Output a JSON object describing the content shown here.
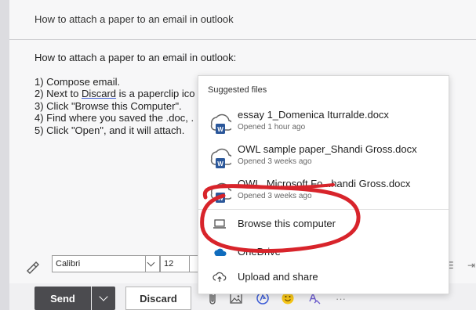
{
  "compose": {
    "subject": "How to attach a paper to an email in outlook",
    "body_title": "How to attach a paper to an email in outlook:",
    "steps": [
      {
        "prefix": "1) Compose email.",
        "link": "",
        "suffix": ""
      },
      {
        "prefix": "2) Next to ",
        "link": "Discard",
        "suffix": " is a paperclip ico"
      },
      {
        "prefix": "3) Click \"Browse this Computer\".",
        "link": "",
        "suffix": ""
      },
      {
        "prefix": "4) Find where you saved the .doc, .",
        "link": "",
        "suffix": ""
      },
      {
        "prefix": "5) Click \"Open\", and it will attach.",
        "link": "",
        "suffix": ""
      }
    ]
  },
  "format_bar": {
    "font": "Calibri",
    "size": "12"
  },
  "toolbar": {
    "send_label": "Send",
    "discard_label": "Discard",
    "more_label": "···"
  },
  "popup": {
    "heading": "Suggested files",
    "files": [
      {
        "name": "essay 1_Domenica Iturralde.docx",
        "time": "Opened 1 hour ago",
        "icon": "word-doc-icon"
      },
      {
        "name": "OWL sample paper_Shandi Gross.docx",
        "time": "Opened 3 weeks ago",
        "icon": "word-doc-icon"
      },
      {
        "name": "OWL_Microsoft Fo...handi Gross.docx",
        "time": "Opened 3 weeks ago",
        "icon": "word-doc-icon"
      }
    ],
    "actions": [
      {
        "label": "Browse this computer",
        "icon": "laptop-icon"
      },
      {
        "label": "OneDrive",
        "icon": "onedrive-icon"
      },
      {
        "label": "Upload and share",
        "icon": "cloud-upload-icon"
      }
    ]
  },
  "colors": {
    "annotation": "#d8242b",
    "send_button": "#4b4b4f",
    "word_blue": "#2b579a",
    "onedrive_blue": "#0f6cbd"
  }
}
